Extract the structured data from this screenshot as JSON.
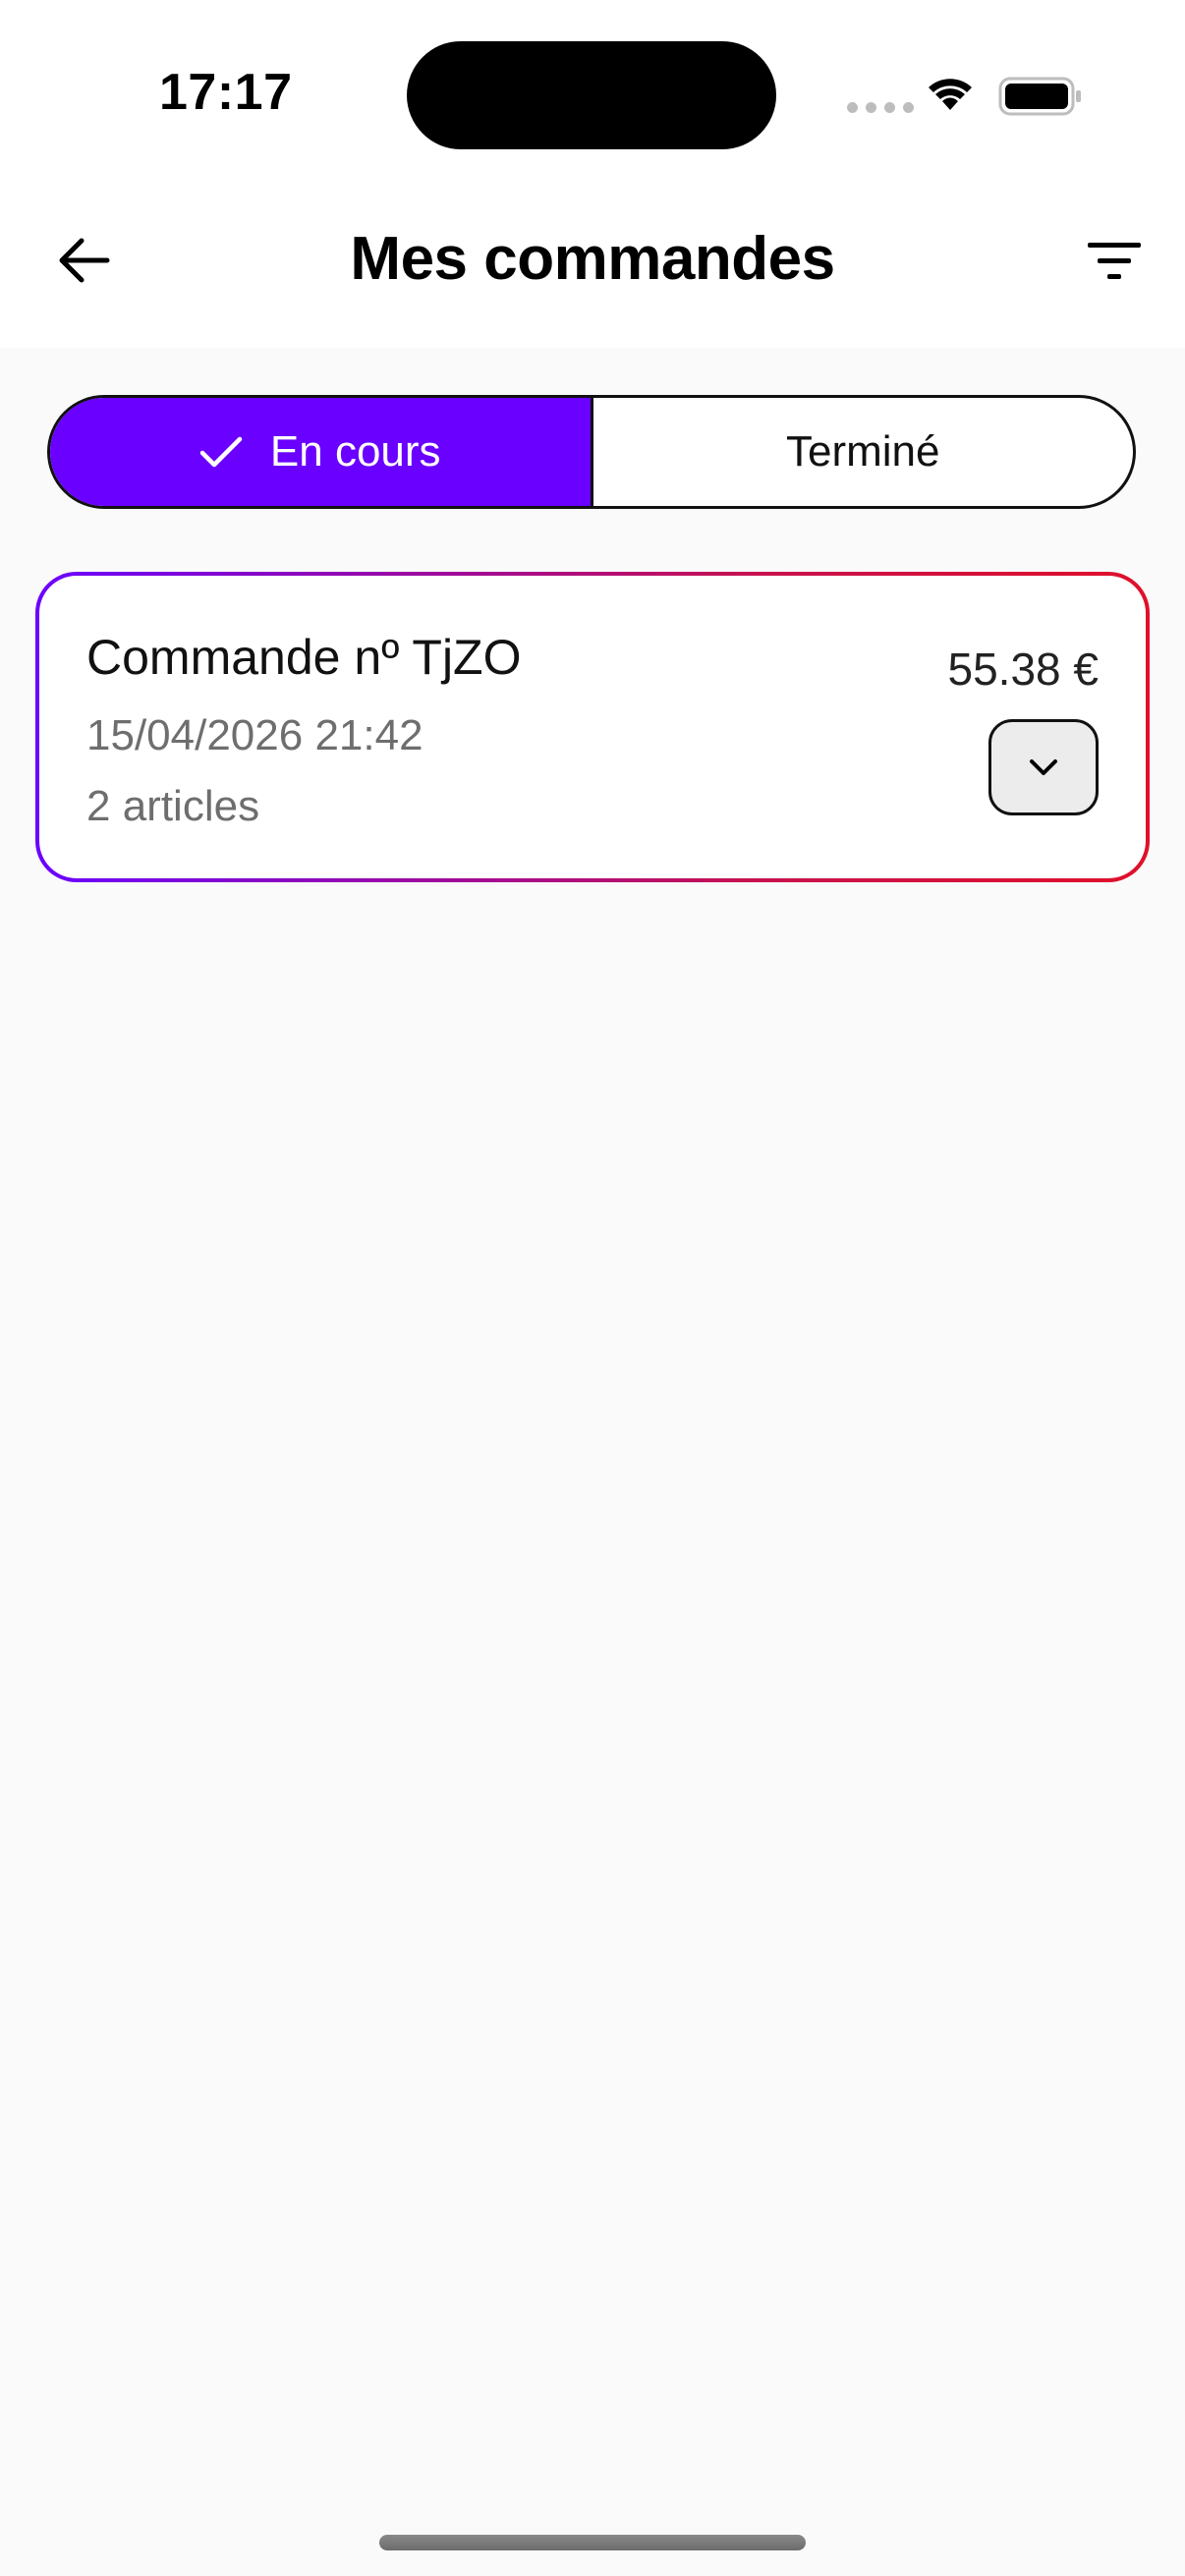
{
  "status_bar": {
    "time": "17:17"
  },
  "header": {
    "title": "Mes commandes",
    "back_icon": "arrow-left-icon",
    "filter_icon": "filter-icon"
  },
  "tabs": [
    {
      "label": "En cours",
      "active": true,
      "icon": "check-icon"
    },
    {
      "label": "Terminé",
      "active": false
    }
  ],
  "orders": [
    {
      "title": "Commande nº TjZO",
      "date": "15/04/2026 21:42",
      "items": "2 articles",
      "price": "55.38 €",
      "expand_icon": "chevron-down-icon"
    }
  ],
  "colors": {
    "accent": "#6a00ff",
    "gradient_end": "#e0102a",
    "background": "#fafafa"
  }
}
